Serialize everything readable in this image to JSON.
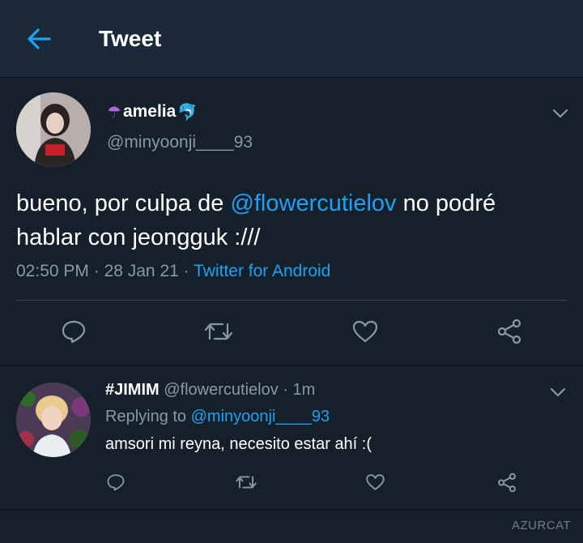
{
  "header": {
    "title": "Tweet",
    "back_icon": "arrow-left-icon",
    "accent": "#1da1f2"
  },
  "tweet": {
    "display_name": "amelia",
    "name_emoji_left": "☂",
    "name_emoji_right": "🐬",
    "handle": "@minyoonji____93",
    "text_before": "bueno, por culpa de ",
    "mention": "@flowercutielov",
    "text_after": " no podré hablar con jeongguk :///",
    "time": "02:50 PM",
    "sep1": " · ",
    "date": "28 Jan 21",
    "sep2": " · ",
    "source": "Twitter for Android",
    "actions": [
      "comment-icon",
      "retweet-icon",
      "heart-icon",
      "share-icon"
    ]
  },
  "reply": {
    "display_name": "#JIMIM",
    "handle": "@flowercutielov",
    "sep": " · ",
    "time": "1m",
    "replying_label": "Replying to ",
    "replying_to": "@minyoonji____93",
    "text": "amsori mi reyna, necesito estar ahí :(",
    "actions": [
      "comment-icon",
      "retweet-icon",
      "heart-icon",
      "share-icon"
    ]
  },
  "watermark": "AZURCAT",
  "colors": {
    "background": "#15202b",
    "header": "#1c2938",
    "secondary_text": "#8899a6",
    "link": "#1da1f2"
  }
}
